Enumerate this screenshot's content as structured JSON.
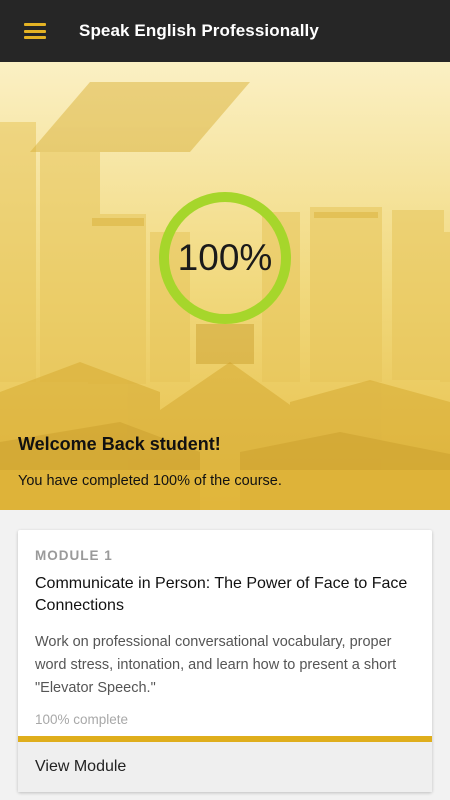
{
  "app_bar": {
    "title": "Speak English Professionally",
    "menu_icon": "hamburger-menu-icon",
    "background": "#262626",
    "accent": "#e4b324"
  },
  "hero": {
    "progress_percent": 100,
    "progress_label": "100%",
    "ring_color": "#a6d62b",
    "welcome": "Welcome Back student!",
    "completion_message": "You have completed 100% of the course."
  },
  "module_card": {
    "module_label": "MODULE 1",
    "title": "Communicate in Person: The Power of Face to Face Connections",
    "description": "Work on professional conversational vocabulary, proper word stress, intonation, and learn how to present a short \"Elevator Speech.\"",
    "progress_text": "100% complete",
    "progress_fraction": 1.0,
    "progress_color": "#dfae1c",
    "action_label": "View Module"
  }
}
